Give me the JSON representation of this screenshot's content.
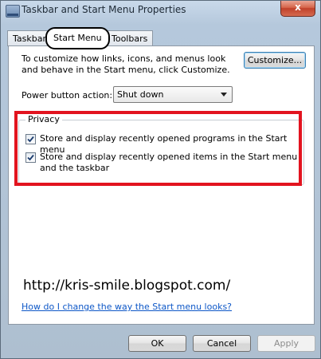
{
  "window": {
    "title": "Taskbar and Start Menu Properties",
    "close_label": "x",
    "close_icon": "close-icon"
  },
  "tabs": [
    {
      "label": "Taskbar"
    },
    {
      "label": "Start Menu",
      "active": true
    },
    {
      "label": "Toolbars"
    }
  ],
  "start_menu": {
    "intro": "To customize how links, icons, and menus look and behave in the Start menu, click Customize.",
    "customize_label": "Customize...",
    "power_label": "Power button action:",
    "power_value": "Shut down"
  },
  "privacy": {
    "legend": "Privacy",
    "items": [
      {
        "label": "Store and display recently opened programs in the Start menu",
        "checked": true
      },
      {
        "label": "Store and display recently opened items in the Start menu and the taskbar",
        "checked": true
      }
    ]
  },
  "watermark": "http://kris-smile.blogspot.com/",
  "help_link": "How do I change the way the Start menu looks?",
  "footer": {
    "ok": "OK",
    "cancel": "Cancel",
    "apply": "Apply"
  },
  "colors": {
    "highlight_box": "#e2141f",
    "link": "#0d57c7"
  }
}
